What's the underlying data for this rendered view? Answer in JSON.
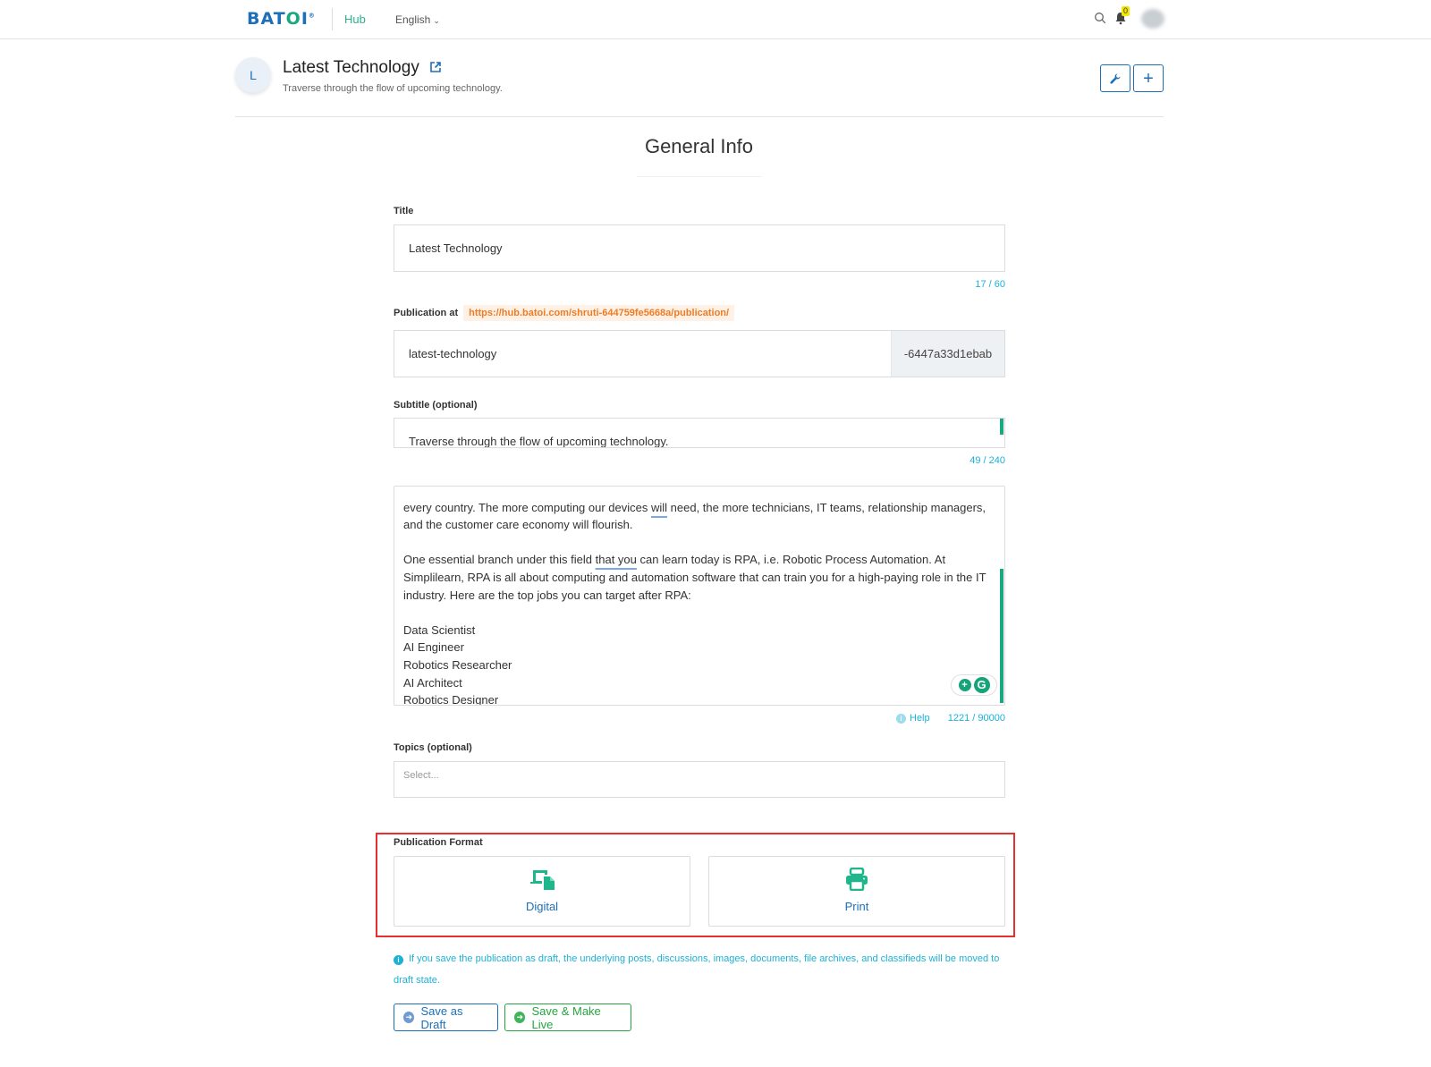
{
  "nav": {
    "logo": {
      "part1": "BAT",
      "part2": "O",
      "part3": "I",
      "reg": "®"
    },
    "hub_label": "Hub",
    "language": "English",
    "notification_count": "0",
    "icons": {
      "search": "search-icon",
      "bell": "bell-icon",
      "chevron": "chevron-down-icon",
      "avatar": "user-avatar"
    }
  },
  "header": {
    "avatar_letter": "L",
    "title": "Latest Technology",
    "subtitle": "Traverse through the flow of upcoming technology.",
    "buttons": {
      "settings": "wrench-icon",
      "add": "+"
    }
  },
  "section_title": "General Info",
  "form": {
    "title": {
      "label": "Title",
      "value": "Latest Technology",
      "counter": "17 / 60"
    },
    "publication_at": {
      "label": "Publication at",
      "url": "https://hub.batoi.com/shruti-644759fe5668a/publication/",
      "slug_value": "latest-technology",
      "slug_suffix": "-6447a33d1ebab"
    },
    "subtitle": {
      "label": "Subtitle (optional)",
      "value": "Traverse through the flow of upcoming technology.",
      "counter": "49 / 240"
    },
    "description": {
      "lines": [
        {
          "text": "every country. The more computing our devices ",
          "u": "will",
          "rest": " need, the more technicians, IT teams, relationship managers,"
        },
        {
          "text": "and the customer care economy will flourish.",
          "u": "",
          "rest": ""
        },
        {
          "text": "",
          "u": "",
          "rest": ""
        },
        {
          "text": "One essential branch under this field ",
          "u": "that you",
          "rest": " can learn today is RPA, i.e. Robotic Process Automation. At"
        },
        {
          "text": "Simplilearn, RPA is all about computing and automation software that can train you for a high-paying role in the IT",
          "u": "",
          "rest": ""
        },
        {
          "text": "industry. Here are the top jobs you can target after RPA:",
          "u": "",
          "rest": ""
        },
        {
          "text": "",
          "u": "",
          "rest": ""
        },
        {
          "text": "Data Scientist",
          "u": "",
          "rest": ""
        },
        {
          "text": "AI Engineer",
          "u": "",
          "rest": ""
        },
        {
          "text": "Robotics Researcher",
          "u": "",
          "rest": ""
        },
        {
          "text": "AI Architect",
          "u": "",
          "rest": ""
        },
        {
          "text": "Robotics Designer",
          "u": "",
          "rest": ""
        }
      ],
      "help_label": "Help",
      "counter": "1221 / 90000",
      "grammarly": {
        "bulb": "+",
        "logo": "G"
      }
    },
    "topics": {
      "label": "Topics (optional)",
      "placeholder": "Select..."
    },
    "publication_format": {
      "label": "Publication Format",
      "options": [
        {
          "label": "Digital",
          "icon": "devices-icon"
        },
        {
          "label": "Print",
          "icon": "printer-icon"
        }
      ]
    },
    "info_note": "If you save the publication as draft, the underlying posts, discussions, images, documents, file archives, and classifieds will be moved to draft state.",
    "buttons": {
      "save_draft": "Save as Draft",
      "save_live": "Save & Make Live"
    }
  },
  "colors": {
    "brand_blue": "#1d6fb8",
    "brand_green": "#1aa880",
    "counter_cyan": "#1bb2d6",
    "url_orange": "#f07c22",
    "highlight_red": "#e53030",
    "live_green": "#26a541"
  }
}
